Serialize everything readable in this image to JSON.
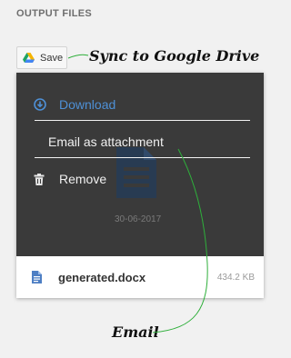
{
  "section": {
    "title": "OUTPUT FILES"
  },
  "toolbar": {
    "save_label": "Save",
    "save_icon": "google-drive-icon"
  },
  "menu": {
    "items": [
      {
        "label": "Download",
        "icon": "download-icon",
        "color": "#4e90d6"
      },
      {
        "label": "Email as attachment"
      },
      {
        "label": "Remove",
        "icon": "trash-icon"
      }
    ]
  },
  "preview": {
    "date": "30-06-2017",
    "icon": "document-icon"
  },
  "file": {
    "name": "generated.docx",
    "size": "434.2 KB",
    "icon": "doc-file-icon"
  },
  "annotations": {
    "sync": "Sync to Google Drive",
    "email": "Email",
    "color": "#2eaf3a"
  }
}
